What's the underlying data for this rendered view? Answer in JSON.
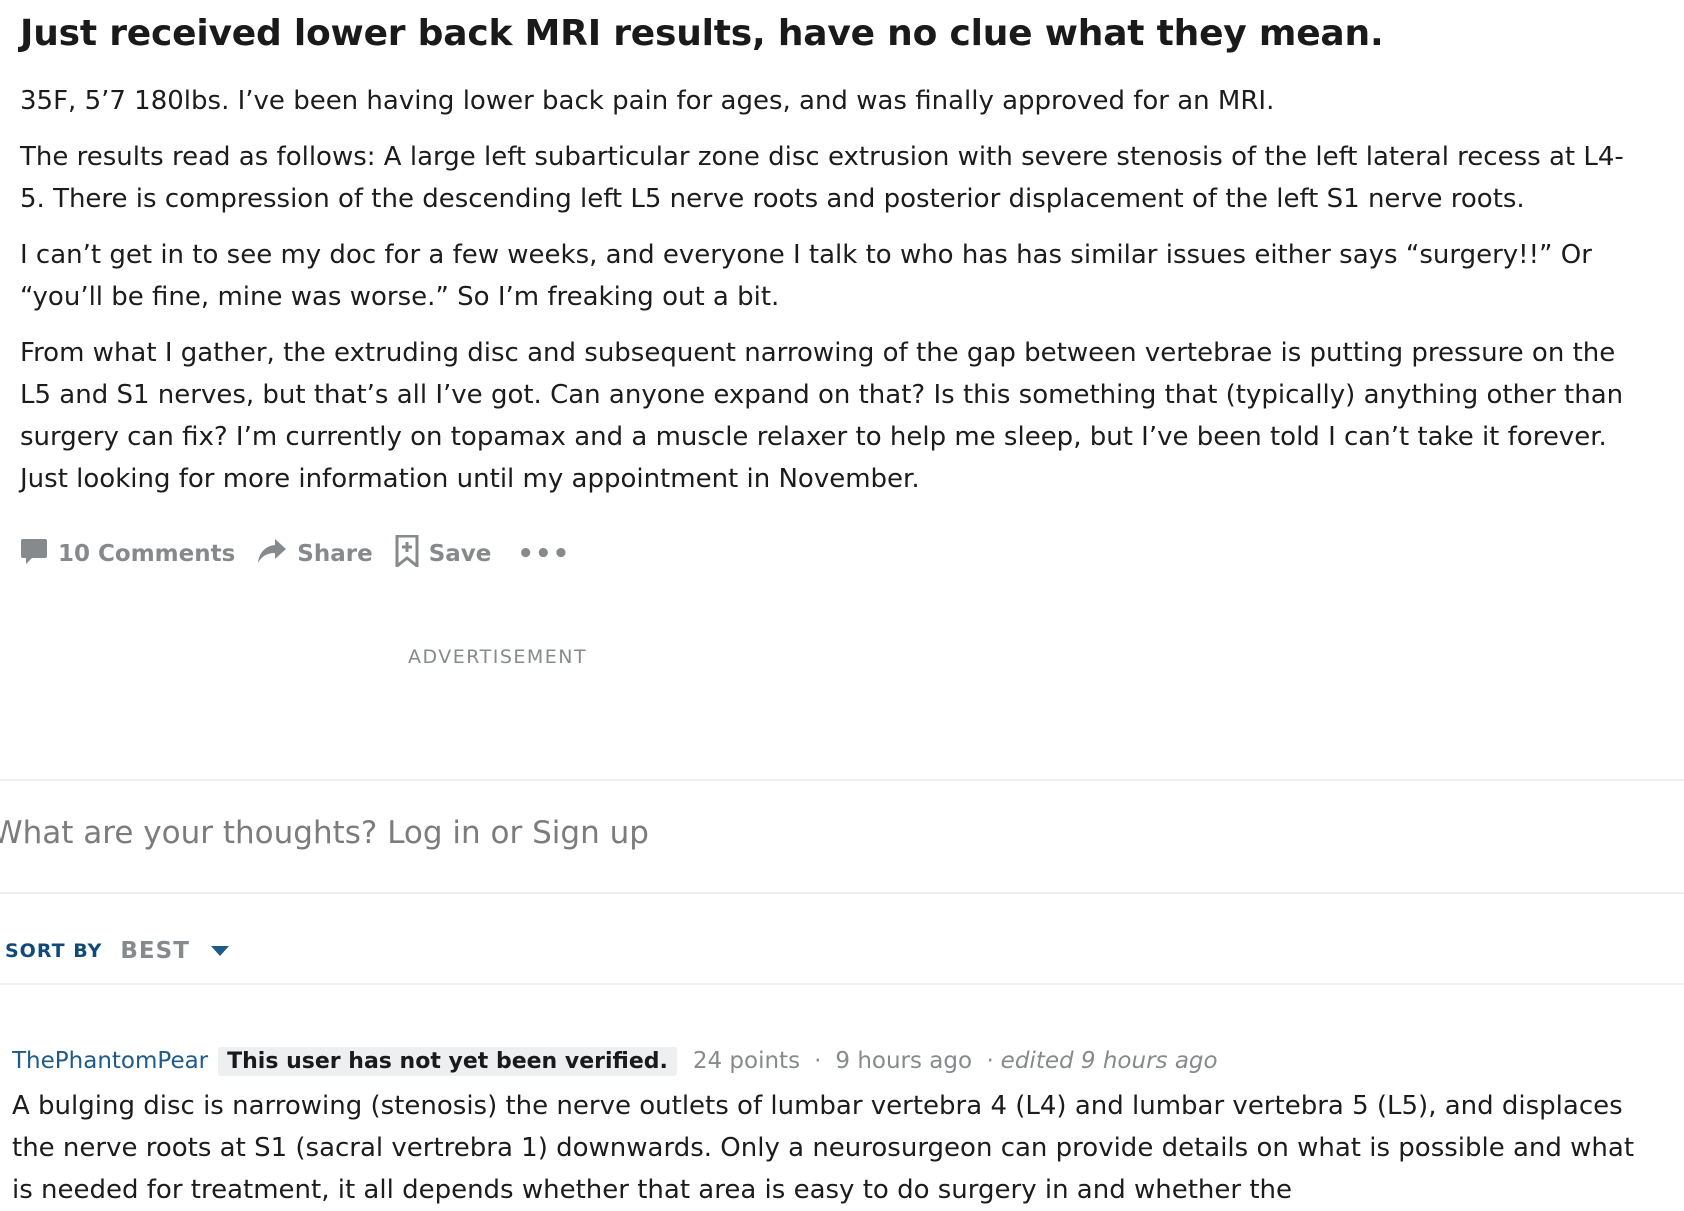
{
  "post": {
    "title": "Just received lower back MRI results, have no clue what they mean.",
    "paragraphs": [
      "35F, 5’7 180lbs. I’ve been having lower back pain for ages, and was finally approved for an MRI.",
      "The results read as follows: A large left subarticular zone disc extrusion with severe stenosis of the left lateral recess at L4-5. There is compression of the descending left L5 nerve roots and posterior displacement of the left S1 nerve roots.",
      "I can’t get in to see my doc for a few weeks, and everyone I talk to who has has similar issues either says “surgery!!” Or “you’ll be fine, mine was worse.” So I’m freaking out a bit.",
      "From what I gather, the extruding disc and subsequent narrowing of the gap between vertebrae is putting pressure on the L5 and S1 nerves, but that’s all I’ve got. Can anyone expand on that? Is this something that (typically) anything other than surgery can fix? I’m currently on topamax and a muscle relaxer to help me sleep, but I’ve been told I can’t take it forever. Just looking for more information until my appointment in November."
    ]
  },
  "actions": {
    "comments_label": "10 Comments",
    "share_label": "Share",
    "save_label": "Save",
    "more_label": "•••",
    "icons": [
      "comment-icon",
      "share-arrow-icon",
      "bookmark-add-icon",
      "more-options-icon"
    ]
  },
  "advertisement_label": "ADVERTISEMENT",
  "comment_box": {
    "placeholder": "What are your thoughts? Log in or Sign up"
  },
  "sort": {
    "label": "SORT BY",
    "value": "BEST",
    "icon": "caret-down-icon"
  },
  "comments": [
    {
      "author": "ThePhantomPear",
      "flair": "This user has not yet been verified.",
      "points": "24 points",
      "separator": "·",
      "time": "9 hours ago",
      "edited": "· edited 9 hours ago",
      "body": "A bulging disc is narrowing (stenosis) the nerve outlets of lumbar vertebra 4 (L4) and lumbar vertebra 5 (L5), and displaces the nerve roots at S1 (sacral vertrebra 1) downwards. Only a neurosurgeon can provide details on what is possible and what is needed for treatment, it all depends whether that area is easy to do surgery in and whether the"
    }
  ],
  "colors": {
    "text": "#1a1a1b",
    "muted": "#878a8c",
    "link": "#1e5a8a",
    "sort_label": "#0f4a7a",
    "divider": "#edeff1",
    "flair_bg": "#edeff1"
  }
}
